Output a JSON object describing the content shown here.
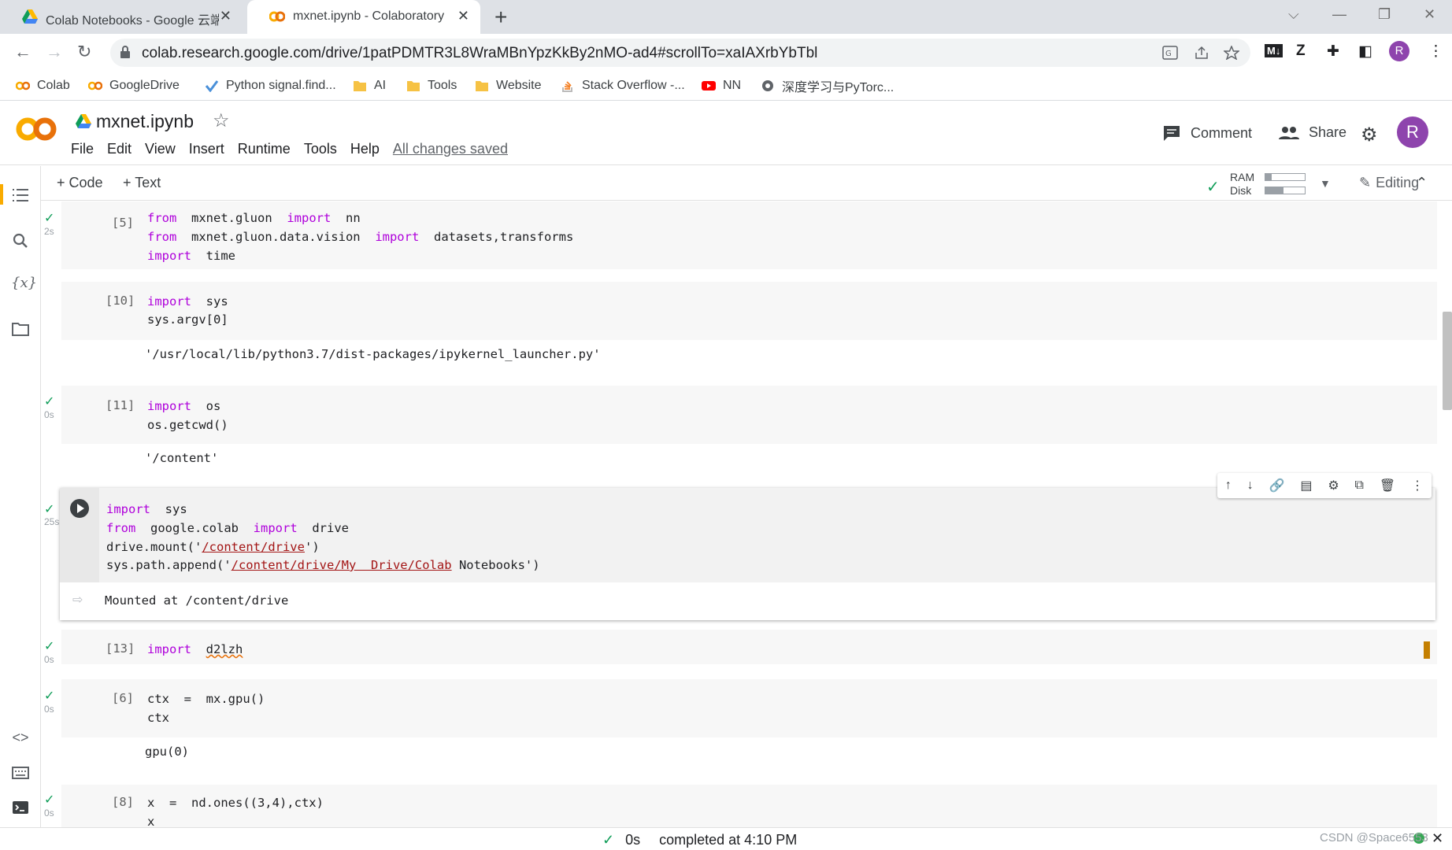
{
  "browser": {
    "tabs": [
      {
        "title": "Colab Notebooks - Google 云端",
        "active": false
      },
      {
        "title": "mxnet.ipynb - Colaboratory",
        "active": true
      }
    ],
    "url": "colab.research.google.com/drive/1patPDMTR3L8WraMBnYpzKkBy2nMO-ad4#scrollTo=xaIAXrbYbTbl",
    "avatar": "R",
    "bookmarks": [
      {
        "label": "Colab",
        "icon": "colab-icon"
      },
      {
        "label": "GoogleDrive",
        "icon": "colab-icon"
      },
      {
        "label": "Python signal.find...",
        "icon": "bookmark-icon"
      },
      {
        "label": "AI",
        "icon": "folder-icon"
      },
      {
        "label": "Tools",
        "icon": "folder-icon"
      },
      {
        "label": "Website",
        "icon": "folder-icon"
      },
      {
        "label": "Stack Overflow -...",
        "icon": "stackoverflow-icon"
      },
      {
        "label": "NN",
        "icon": "youtube-icon"
      },
      {
        "label": "深度学习与PyTorc...",
        "icon": "globe-icon"
      }
    ]
  },
  "colab": {
    "notebook_title": "mxnet.ipynb",
    "menu": [
      "File",
      "Edit",
      "View",
      "Insert",
      "Runtime",
      "Tools",
      "Help"
    ],
    "saved_status": "All changes saved",
    "comment_label": "Comment",
    "share_label": "Share",
    "avatar": "R",
    "add_code": "+ Code",
    "add_text": "+ Text",
    "ram_label": "RAM",
    "disk_label": "Disk",
    "ram_usage": 0.15,
    "disk_usage": 0.45,
    "editing_label": "Editing"
  },
  "cells": {
    "c5": {
      "exec": "[5]",
      "dur": "2s",
      "l1": "mxnet.gluon",
      "l1b": "nn",
      "l2": "mxnet.gluon.data.vision",
      "l2b": "datasets,transforms",
      "l3": "time",
      "kw_from": "from",
      "kw_import": "import"
    },
    "c10": {
      "exec": "[10]",
      "l1": "sys",
      "l2": "sys.argv[0]",
      "out": "'/usr/local/lib/python3.7/dist-packages/ipykernel_launcher.py'"
    },
    "c11": {
      "exec": "[11]",
      "dur": "0s",
      "l1": "os",
      "l2": "os.getcwd()",
      "out": "'/content'"
    },
    "c12": {
      "dur": "25s",
      "l1": "sys",
      "l2a": "google.colab",
      "l2b": "drive",
      "l3a": "drive.mount('",
      "l3s": "/content/drive",
      "l3b": "')",
      "l4a": "sys.path.append('",
      "l4s": "/content/drive/My  Drive/Colab",
      "l4b": " Notebooks')",
      "out": "Mounted at /content/drive"
    },
    "c13": {
      "exec": "[13]",
      "dur": "0s",
      "l1": "d2lzh"
    },
    "c6": {
      "exec": "[6]",
      "dur": "0s",
      "l1": "ctx  =  mx.gpu()",
      "l2": "ctx",
      "out": "gpu(0)"
    },
    "c8": {
      "exec": "[8]",
      "dur": "0s",
      "l1": "x  =  nd.ones((3,4),ctx)",
      "l2": "x"
    }
  },
  "status": {
    "duration": "0s",
    "text": "completed at 4:10 PM",
    "watermark": "CSDN @Space6553"
  }
}
